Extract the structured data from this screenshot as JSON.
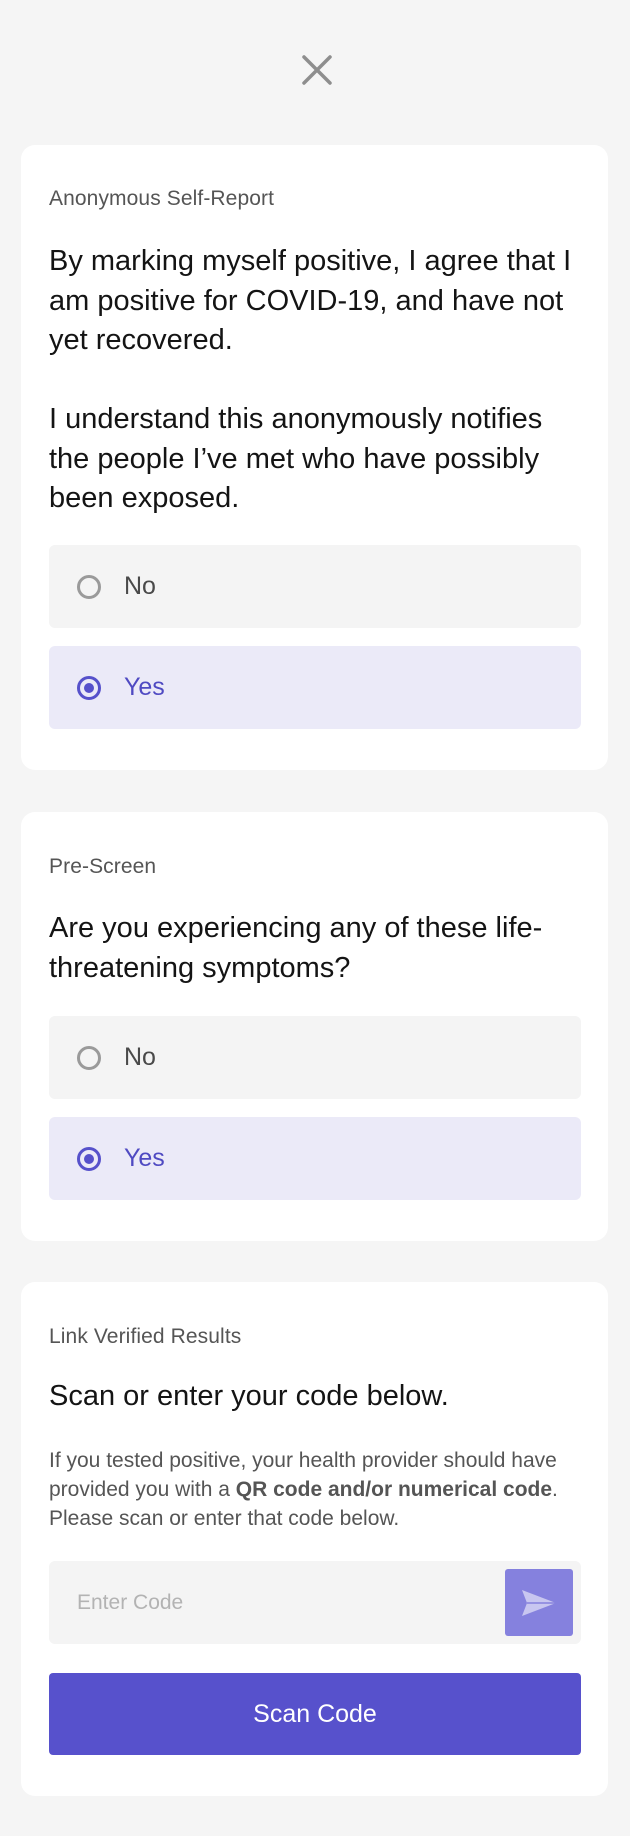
{
  "colors": {
    "accent": "#5751cc",
    "selected_bg": "#ebeaf8",
    "option_bg": "#f4f4f4",
    "page_bg": "#f5f5f5"
  },
  "header": {
    "close_icon": "close-icon"
  },
  "self_report": {
    "eyebrow": "Anonymous Self-Report",
    "paragraph_1": "By marking myself positive, I agree that I am positive for COVID-19, and have not yet recovered.",
    "paragraph_2": "I understand this anonymously notifies the people I’ve met who have possibly been exposed.",
    "options": [
      {
        "label": "No",
        "selected": false
      },
      {
        "label": "Yes",
        "selected": true
      }
    ]
  },
  "pre_screen": {
    "eyebrow": "Pre-Screen",
    "question": "Are you experiencing any of these life-threatening symptoms?",
    "options": [
      {
        "label": "No",
        "selected": false
      },
      {
        "label": "Yes",
        "selected": true
      }
    ]
  },
  "verified_results": {
    "eyebrow": "Link Verified Results",
    "heading": "Scan or enter your code below.",
    "body_before": "If you tested positive, your health provider should have provided you with a ",
    "body_bold": "QR code and/or numerical code",
    "body_after": ". Please scan or enter that code below.",
    "code_placeholder": "Enter Code",
    "code_value": "",
    "send_icon": "send-icon",
    "scan_button_label": "Scan Code"
  }
}
